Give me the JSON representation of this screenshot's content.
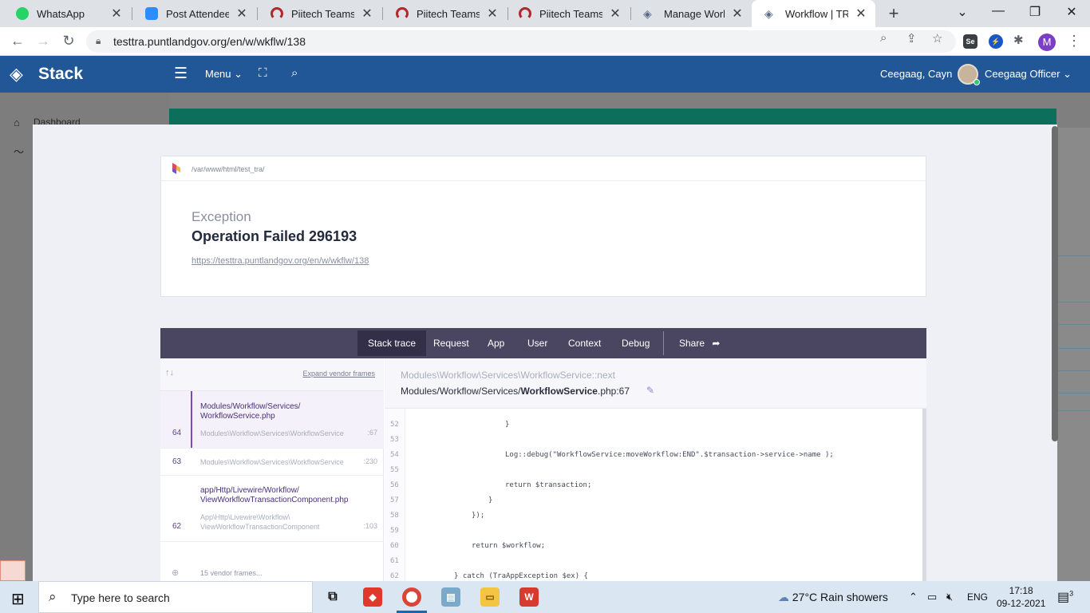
{
  "browser": {
    "tabs": [
      {
        "title": "WhatsApp",
        "icon": "whatsapp-icon",
        "color": "#25d366"
      },
      {
        "title": "Post Attendee - Z",
        "icon": "zoom-icon",
        "color": "#2d8cff"
      },
      {
        "title": "Piitech Teams Po",
        "icon": "piitech-icon",
        "color": "#b1272b"
      },
      {
        "title": "Piitech Teams Po",
        "icon": "piitech-icon",
        "color": "#b1272b"
      },
      {
        "title": "Piitech Teams Po",
        "icon": "piitech-icon",
        "color": "#b1272b"
      },
      {
        "title": "Manage Workflow",
        "icon": "stack-icon",
        "color": "#215797"
      },
      {
        "title": "Workflow | TRA A",
        "icon": "stack-icon",
        "color": "#215797"
      }
    ],
    "url": "testtra.puntlandgov.org/en/w/wkflw/138",
    "profile_initial": "M",
    "extension_label": "Se"
  },
  "app": {
    "brand": "Stack",
    "menu_label": "Menu",
    "user_name": "Ceegaag, Cayn",
    "user_role": "Ceegaag Officer",
    "header_color": "#215797"
  },
  "background": {
    "sidebar_item": "Dashboard"
  },
  "error": {
    "path": "/var/www/html/test_tra/",
    "kind": "Exception",
    "message": "Operation Failed 296193",
    "url": "https://testtra.puntlandgov.org/en/w/wkflw/138",
    "nav": [
      "Stack trace",
      "Request",
      "App",
      "User",
      "Context",
      "Debug"
    ],
    "share_label": "Share",
    "expand_vendor": "Expand vendor frames",
    "frames": [
      {
        "number": "64",
        "file": [
          "Modules/Workflow/Services/",
          "WorkflowService.php"
        ],
        "class": "Modules\\Workflow\\Services\\WorkflowService",
        "line": ":67"
      },
      {
        "number": "63",
        "class": "Modules\\Workflow\\Services\\WorkflowService",
        "line": ":230"
      },
      {
        "number": "62",
        "file": [
          "app/Http/Livewire/Workflow/",
          "ViewWorkflowTransactionComponent.php"
        ],
        "class": [
          "App\\Http\\Livewire\\Workflow\\",
          "ViewWorkflowTransactionComponent"
        ],
        "line": ":103"
      }
    ],
    "vendor_frames": "15 vendor frames...",
    "code_class": "Modules\\Workflow\\Services\\WorkflowService::next",
    "code_file_prefix": "Modules/Workflow/Services/",
    "code_file_name": "WorkflowService",
    "code_file_suffix": ".php:67",
    "code_lines": [
      {
        "num": "52",
        "text": "}"
      },
      {
        "num": "53",
        "text": ""
      },
      {
        "num": "54",
        "text": "Log::debug(\"WorkflowService:moveWorkflow:END\".$transaction->service->name );"
      },
      {
        "num": "55",
        "text": ""
      },
      {
        "num": "56",
        "text": "return $transaction;"
      },
      {
        "num": "57",
        "text": "}"
      },
      {
        "num": "58",
        "text": "});"
      },
      {
        "num": "59",
        "text": ""
      },
      {
        "num": "60",
        "text": "return $workflow;"
      },
      {
        "num": "61",
        "text": ""
      },
      {
        "num": "62",
        "text": "} catch (TraAppException $ex) {"
      }
    ]
  },
  "taskbar": {
    "search_placeholder": "Type here to search",
    "weather": "27°C  Rain showers",
    "language": "ENG",
    "time": "17:18",
    "date": "09-12-2021",
    "notifications": "3"
  }
}
